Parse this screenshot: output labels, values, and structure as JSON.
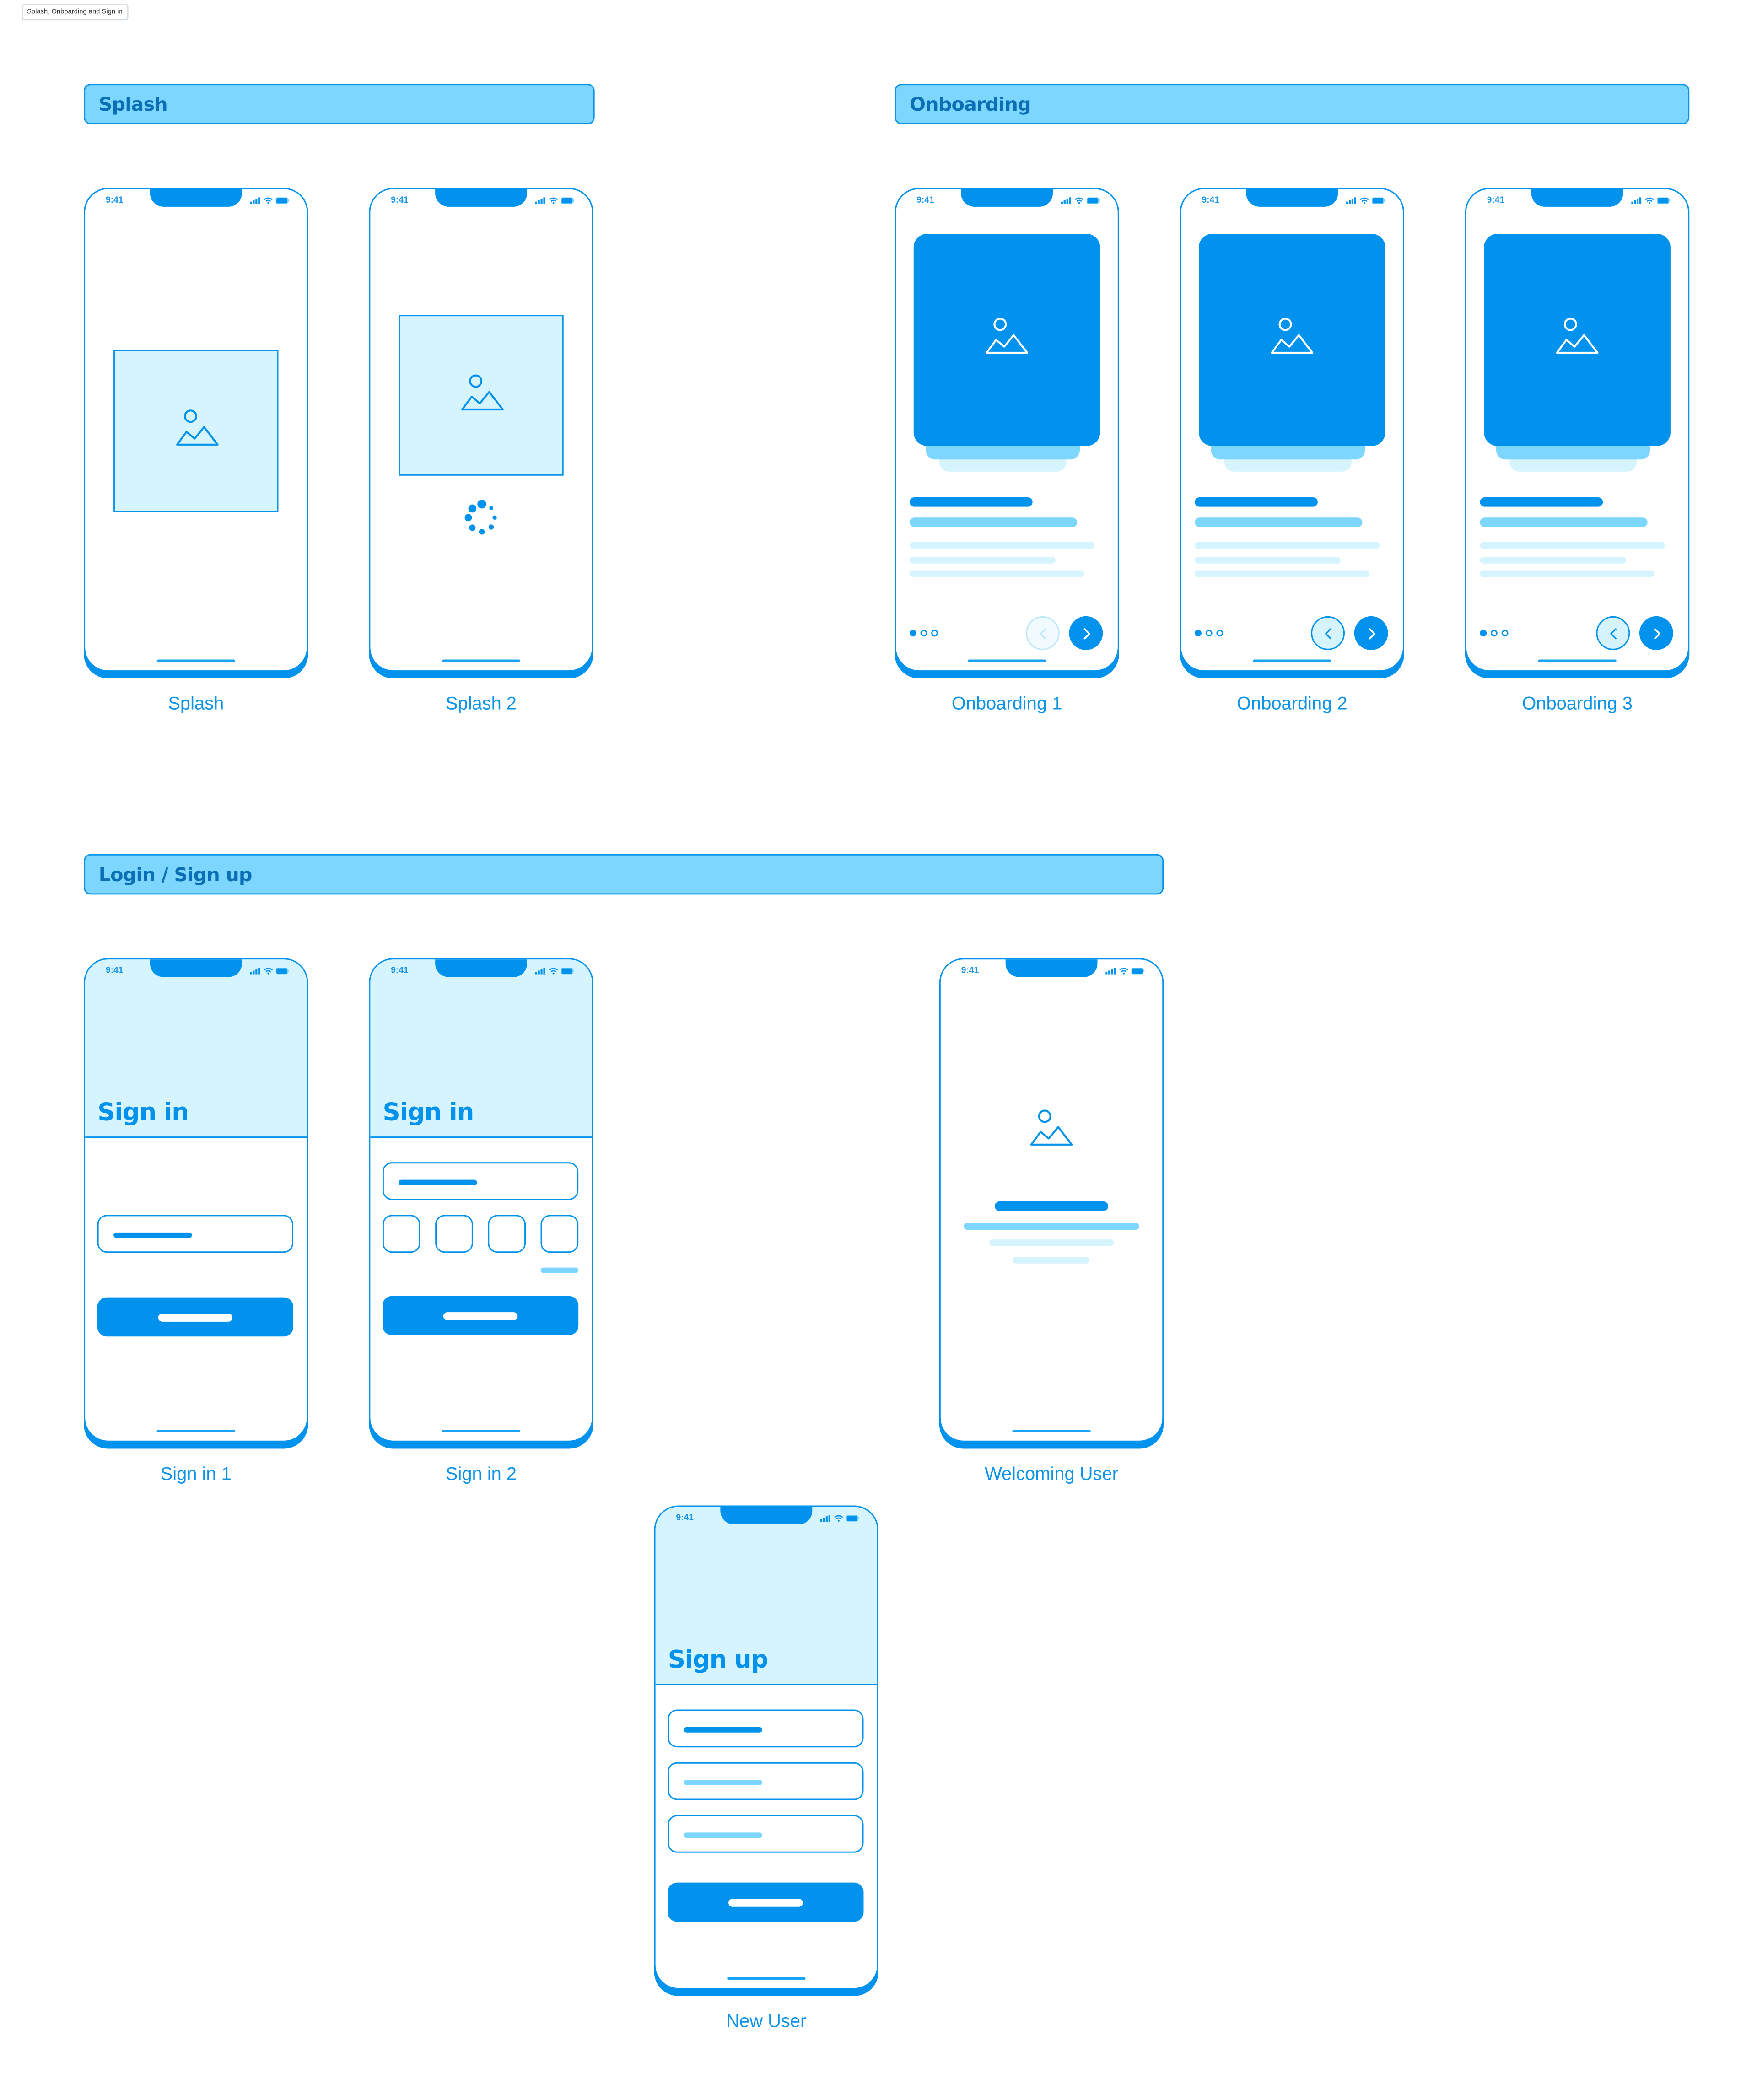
{
  "canvas": {
    "frame_tag": "Splash, Onboarding and Sign in",
    "colors": {
      "primary": "#0092ec",
      "mid": "#7dd6fe",
      "light": "#d6f4fe",
      "header_text": "#0a6fb5"
    }
  },
  "sections": {
    "splash": {
      "title": "Splash"
    },
    "onboarding": {
      "title": "Onboarding"
    },
    "login": {
      "title": "Login / Sign up"
    }
  },
  "status_bar": {
    "time": "9:41",
    "icons": [
      "signal-icon",
      "wifi-icon",
      "battery-icon"
    ]
  },
  "screens": {
    "splash_1": {
      "caption": "Splash",
      "icon": "image-placeholder-icon"
    },
    "splash_2": {
      "caption": "Splash 2",
      "icon": "image-placeholder-icon",
      "loader": "spinner-icon"
    },
    "onboarding_1": {
      "caption": "Onboarding 1",
      "page_dots": 3,
      "active_dot": 1,
      "back_enabled": false
    },
    "onboarding_2": {
      "caption": "Onboarding 2",
      "page_dots": 3,
      "active_dot": 1,
      "back_enabled": true
    },
    "onboarding_3": {
      "caption": "Onboarding 3",
      "page_dots": 3,
      "active_dot": 1,
      "back_enabled": true
    },
    "sign_in_1": {
      "caption": "Sign in 1",
      "title": "Sign in",
      "fields": 1,
      "icon_button": "primary-button"
    },
    "sign_in_2": {
      "caption": "Sign in 2",
      "title": "Sign in",
      "fields": 1,
      "otp_boxes": 4
    },
    "welcoming_user": {
      "caption": "Welcoming User",
      "icon": "image-placeholder-icon"
    },
    "new_user": {
      "caption": "New User",
      "title": "Sign up",
      "fields": 3
    }
  }
}
